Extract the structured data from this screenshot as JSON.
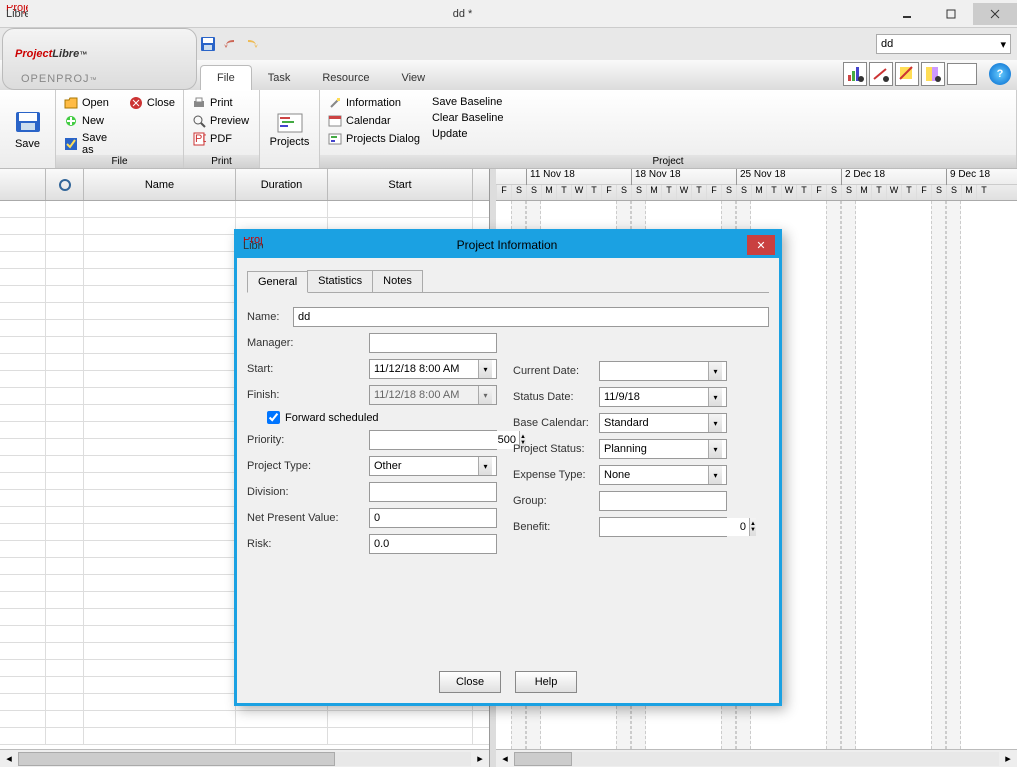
{
  "window": {
    "title": "dd *"
  },
  "logo": {
    "brand_a": "Project",
    "brand_b": "Libre",
    "tm": "™",
    "sub": "OPENPROJ",
    "sub_tm": "™"
  },
  "project_dropdown": {
    "value": "dd"
  },
  "tabs": {
    "file": "File",
    "task": "Task",
    "resource": "Resource",
    "view": "View"
  },
  "ribbon": {
    "file_group": {
      "label": "File",
      "save": "Save",
      "open": "Open",
      "new": "New",
      "close": "Close",
      "save_as": "Save as"
    },
    "print_group": {
      "label": "Print",
      "print": "Print",
      "preview": "Preview",
      "pdf": "PDF"
    },
    "projects_group": {
      "label": "Projects",
      "projects": "Projects"
    },
    "project_group": {
      "label": "Project",
      "information": "Information",
      "calendar": "Calendar",
      "projects_dialog": "Projects Dialog",
      "save_baseline": "Save Baseline",
      "clear_baseline": "Clear Baseline",
      "update": "Update"
    }
  },
  "grid": {
    "headers": {
      "blank": "",
      "info": "",
      "name": "Name",
      "duration": "Duration",
      "start": "Start"
    }
  },
  "timeline": {
    "weeks": [
      "11 Nov 18",
      "18 Nov 18",
      "25 Nov 18",
      "2 Dec 18",
      "9 Dec 18"
    ],
    "day_letters": [
      "F",
      "S",
      "S",
      "M",
      "T",
      "W",
      "T",
      "F",
      "S",
      "S",
      "M",
      "T",
      "W",
      "T",
      "F",
      "S",
      "S",
      "M",
      "T",
      "W",
      "T",
      "F",
      "S",
      "S",
      "M",
      "T",
      "W",
      "T",
      "F",
      "S",
      "S",
      "M",
      "T"
    ]
  },
  "dialog": {
    "title": "Project Information",
    "tabs": {
      "general": "General",
      "statistics": "Statistics",
      "notes": "Notes"
    },
    "labels": {
      "name": "Name:",
      "manager": "Manager:",
      "start": "Start:",
      "finish": "Finish:",
      "forward": "Forward scheduled",
      "priority": "Priority:",
      "project_type": "Project Type:",
      "division": "Division:",
      "npv": "Net Present Value:",
      "risk": "Risk:",
      "current_date": "Current Date:",
      "status_date": "Status Date:",
      "base_calendar": "Base Calendar:",
      "project_status": "Project Status:",
      "expense_type": "Expense Type:",
      "group": "Group:",
      "benefit": "Benefit:"
    },
    "values": {
      "name": "dd",
      "manager": "",
      "start": "11/12/18 8:00 AM",
      "finish": "11/12/18 8:00 AM",
      "forward": true,
      "priority": "500",
      "project_type": "Other",
      "division": "",
      "npv": "0",
      "risk": "0.0",
      "current_date": "",
      "status_date": "11/9/18",
      "base_calendar": "Standard",
      "project_status": "Planning",
      "expense_type": "None",
      "group": "",
      "benefit": "0"
    },
    "buttons": {
      "close": "Close",
      "help": "Help"
    }
  }
}
